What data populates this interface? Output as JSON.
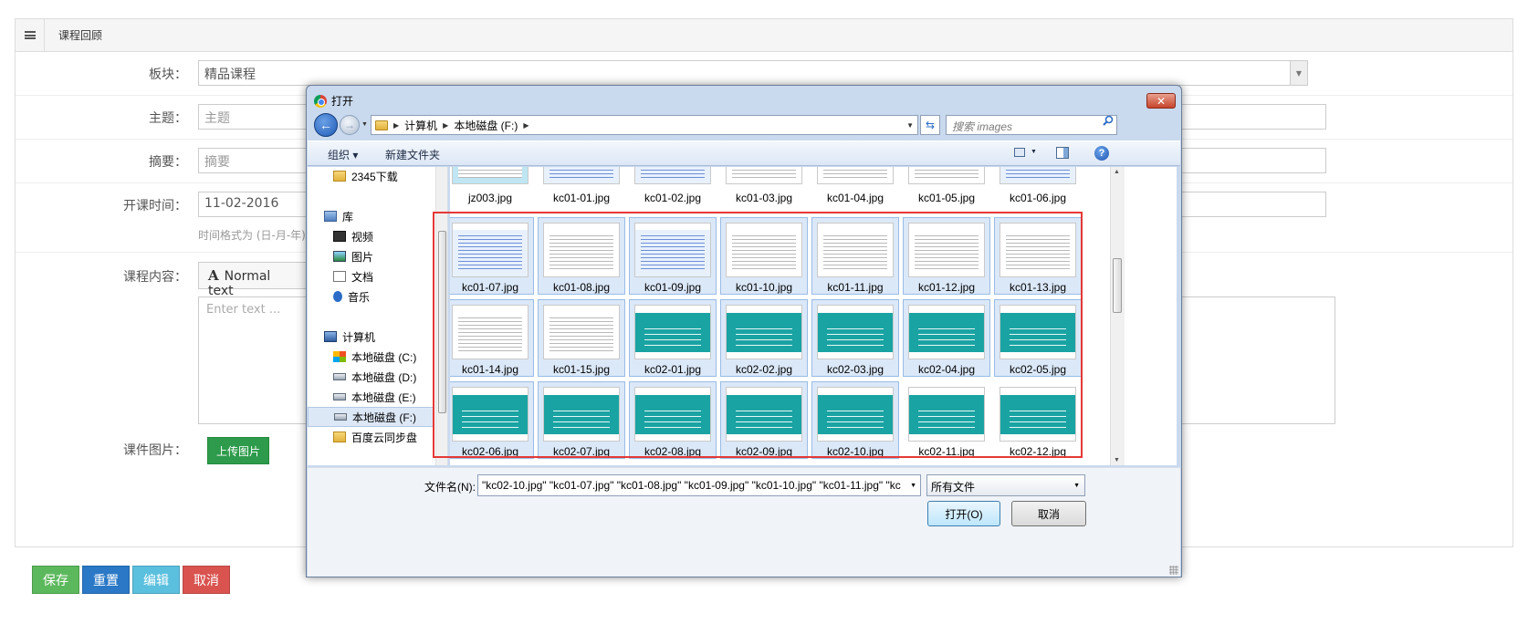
{
  "page": {
    "panel_title": "课程回顾",
    "labels": {
      "block": "板块：",
      "subject": "主题：",
      "summary": "摘要：",
      "start_time": "开课时间：",
      "content": "课程内容：",
      "images": "课件图片："
    },
    "block_value": "精品课程",
    "subject_placeholder": "主题",
    "summary_placeholder": "摘要",
    "start_time_value": "11-02-2016",
    "time_hint": "时间格式为 (日-月-年)",
    "editor_format": "Normal text",
    "editor_placeholder": "Enter text ...",
    "upload_label": "上传图片",
    "buttons": {
      "save": "保存",
      "reset": "重置",
      "edit": "编辑",
      "cancel": "取消"
    }
  },
  "dialog": {
    "title": "打开",
    "address": [
      "计算机",
      "本地磁盘 (F:)"
    ],
    "search_placeholder": "搜索 images",
    "organize": "组织",
    "new_folder": "新建文件夹",
    "nav_items": [
      {
        "label": "2345下载",
        "icon": "folder-icon"
      },
      {
        "label": "库",
        "icon": "library-icon"
      },
      {
        "label": "视频",
        "icon": "video-icon"
      },
      {
        "label": "图片",
        "icon": "picture-icon"
      },
      {
        "label": "文档",
        "icon": "document-icon"
      },
      {
        "label": "音乐",
        "icon": "music-icon"
      },
      {
        "label": "计算机",
        "icon": "computer-icon"
      },
      {
        "label": "本地磁盘 (C:)",
        "icon": "windows-drive-icon"
      },
      {
        "label": "本地磁盘 (D:)",
        "icon": "drive-icon"
      },
      {
        "label": "本地磁盘 (E:)",
        "icon": "drive-icon"
      },
      {
        "label": "本地磁盘 (F:)",
        "icon": "drive-icon",
        "selected": true
      },
      {
        "label": "百度云同步盘",
        "icon": "folder-icon"
      }
    ],
    "files": [
      {
        "name": "jz003.jpg",
        "style": "light",
        "selected": false
      },
      {
        "name": "kc01-01.jpg",
        "style": "blue",
        "selected": false
      },
      {
        "name": "kc01-02.jpg",
        "style": "blue",
        "selected": false
      },
      {
        "name": "kc01-03.jpg",
        "style": "plain",
        "selected": false
      },
      {
        "name": "kc01-04.jpg",
        "style": "plain",
        "selected": false
      },
      {
        "name": "kc01-05.jpg",
        "style": "plain",
        "selected": false
      },
      {
        "name": "kc01-06.jpg",
        "style": "blue",
        "selected": false
      },
      {
        "name": "kc01-07.jpg",
        "style": "blue",
        "selected": true
      },
      {
        "name": "kc01-08.jpg",
        "style": "plain",
        "selected": true
      },
      {
        "name": "kc01-09.jpg",
        "style": "blue",
        "selected": true
      },
      {
        "name": "kc01-10.jpg",
        "style": "plain",
        "selected": true
      },
      {
        "name": "kc01-11.jpg",
        "style": "plain",
        "selected": true
      },
      {
        "name": "kc01-12.jpg",
        "style": "plain",
        "selected": true
      },
      {
        "name": "kc01-13.jpg",
        "style": "plain",
        "selected": true
      },
      {
        "name": "kc01-14.jpg",
        "style": "plain",
        "selected": true
      },
      {
        "name": "kc01-15.jpg",
        "style": "plain",
        "selected": true
      },
      {
        "name": "kc02-01.jpg",
        "style": "teal",
        "selected": true
      },
      {
        "name": "kc02-02.jpg",
        "style": "teal",
        "selected": true
      },
      {
        "name": "kc02-03.jpg",
        "style": "teal",
        "selected": true
      },
      {
        "name": "kc02-04.jpg",
        "style": "teal",
        "selected": true
      },
      {
        "name": "kc02-05.jpg",
        "style": "teal",
        "selected": true
      },
      {
        "name": "kc02-06.jpg",
        "style": "teal",
        "selected": true
      },
      {
        "name": "kc02-07.jpg",
        "style": "teal",
        "selected": true
      },
      {
        "name": "kc02-08.jpg",
        "style": "teal",
        "selected": true
      },
      {
        "name": "kc02-09.jpg",
        "style": "teal",
        "selected": true
      },
      {
        "name": "kc02-10.jpg",
        "style": "teal",
        "selected": true
      },
      {
        "name": "kc02-11.jpg",
        "style": "teal",
        "selected": false
      },
      {
        "name": "kc02-12.jpg",
        "style": "teal",
        "selected": false
      }
    ],
    "filename_label": "文件名(N):",
    "filename_value": "\"kc02-10.jpg\" \"kc01-07.jpg\" \"kc01-08.jpg\" \"kc01-09.jpg\" \"kc01-10.jpg\" \"kc01-11.jpg\" \"kc",
    "filetype_value": "所有文件",
    "open_label": "打开(O)",
    "cancel_label": "取消"
  },
  "colors": {
    "selection_box": "#e53935",
    "save": "#5cb85c",
    "reset": "#2a78c6",
    "edit": "#5bc0de",
    "cancel": "#d9534f"
  }
}
